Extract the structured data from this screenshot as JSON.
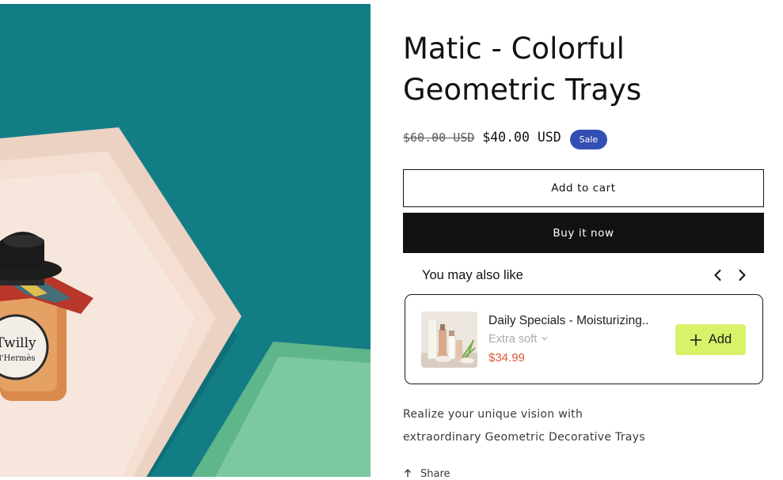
{
  "product": {
    "title": "Matic - Colorful Geometric Trays",
    "price_regular": "$60.00 USD",
    "price_sale": "$40.00 USD",
    "badge": "Sale",
    "add_to_cart_label": "Add to cart",
    "buy_now_label": "Buy it now",
    "description_line_1": "Realize your unique vision with",
    "description_line_2": "extraordinary Geometric Decorative Trays",
    "share_label": "Share"
  },
  "recommendations": {
    "heading": "You may also like",
    "prev_icon": "chevron-left-icon",
    "next_icon": "chevron-right-icon",
    "items": [
      {
        "name": "Daily Specials - Moisturizing..",
        "variant": "Extra soft",
        "price": "$34.99",
        "add_label": "Add",
        "add_icon": "plus-icon"
      }
    ]
  },
  "image": {
    "brand_label_line_1": "Twilly",
    "brand_label_line_2": "d'Hermès"
  },
  "colors": {
    "background_teal": "#137d86",
    "sale_badge": "#334fb4",
    "buy_button": "#121212",
    "add_button": "#d8f26a",
    "reco_price": "#e05a35"
  }
}
